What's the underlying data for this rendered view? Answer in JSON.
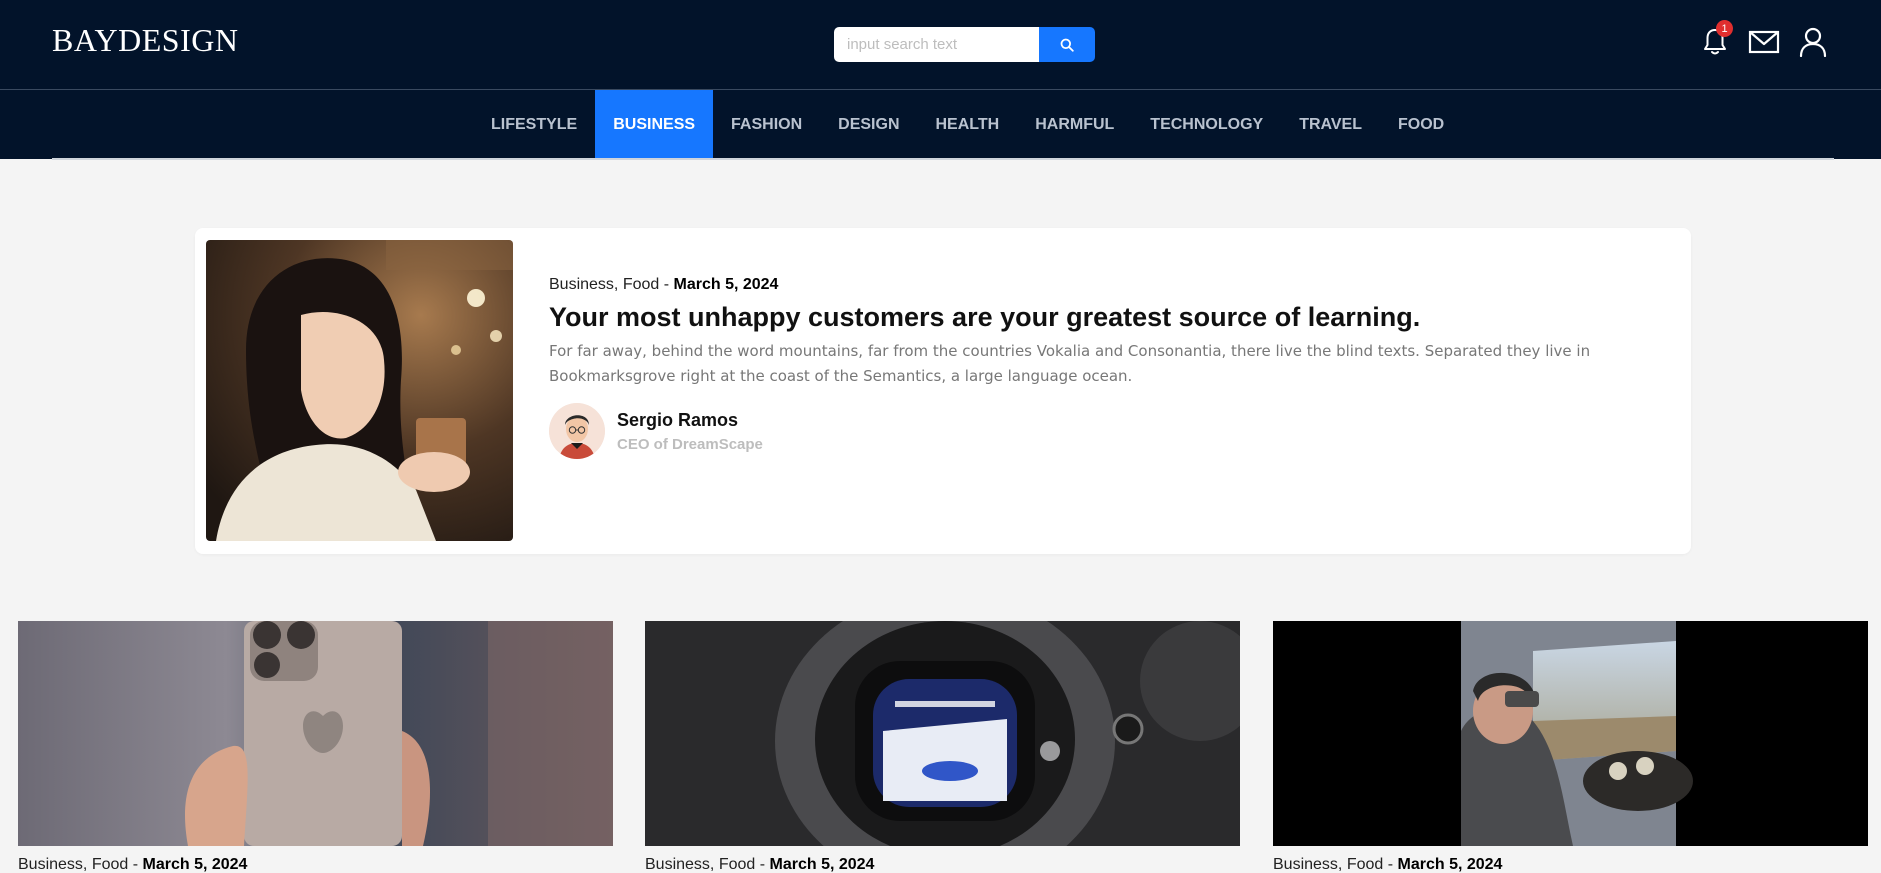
{
  "header": {
    "logo": "BAYDESIGN",
    "search": {
      "placeholder": "input search text",
      "value": ""
    },
    "notifications": {
      "count": "1"
    },
    "icons": [
      "bell-icon",
      "mail-icon",
      "user-icon",
      "search-icon"
    ],
    "colors": {
      "background": "#02132a",
      "accent": "#1677ff",
      "badge": "#e02e2e"
    }
  },
  "nav": {
    "items": [
      {
        "label": "LIFESTYLE"
      },
      {
        "label": "BUSINESS",
        "active": true
      },
      {
        "label": "FASHION"
      },
      {
        "label": "DESIGN"
      },
      {
        "label": "HEALTH"
      },
      {
        "label": "HARMFUL"
      },
      {
        "label": "TECHNOLOGY"
      },
      {
        "label": "TRAVEL"
      },
      {
        "label": "FOOD"
      }
    ]
  },
  "featured": {
    "category_1": "Business",
    "category_2": "Food",
    "date": "March 5, 2024",
    "title": "Your most unhappy customers are your greatest source of learning.",
    "excerpt": "For far away, behind the word mountains, far from the countries Vokalia and Consonantia, there live the blind texts. Separated they live in Bookmarksgrove right at the coast of the Semantics, a large language ocean.",
    "author": {
      "name": "Sergio Ramos",
      "role": "CEO of DreamScape"
    }
  },
  "posts": [
    {
      "category_1": "Business",
      "category_2": "Food",
      "date": "March 5, 2024"
    },
    {
      "category_1": "Business",
      "category_2": "Food",
      "date": "March 5, 2024"
    },
    {
      "category_1": "Business",
      "category_2": "Food",
      "date": "March 5, 2024"
    }
  ]
}
